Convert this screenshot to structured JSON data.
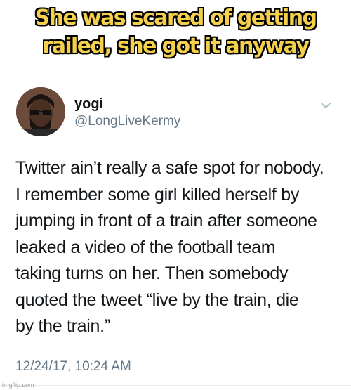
{
  "meme": {
    "caption_line1": "She was scared of getting",
    "caption_line2": "railed, she got it anyway"
  },
  "tweet": {
    "author_name": "yogi",
    "author_handle": "@LongLiveKermy",
    "body_lines": [
      "Twitter ain’t really a safe spot for nobody.",
      "I remember some girl killed herself by",
      "jumping in front of a train after someone",
      "leaked a video of the football team",
      "taking turns on her. Then somebody",
      "quoted the tweet “live by the train, die",
      "by the train.”"
    ],
    "timestamp": "12/24/17, 10:24 AM",
    "menu_icon": "chevron-down-icon"
  },
  "watermark": "imgflip.com",
  "colors": {
    "caption_fill": "#f5d04a",
    "caption_outline": "#000000",
    "text_primary": "#14171a",
    "text_secondary": "#657786"
  }
}
